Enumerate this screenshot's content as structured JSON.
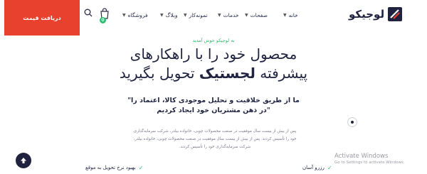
{
  "header": {
    "quote_button": "دریافت قیمت",
    "cart_count": "0",
    "logo_text": "لوجیکو",
    "nav": {
      "home": "خانه",
      "pages": "صفحات",
      "services": "خدمات",
      "sample": "نمونه‌کار",
      "blog": "وبلاگ",
      "shop": "فروشگاه"
    }
  },
  "hero": {
    "kicker": "به لوجیکو خوش آمدید",
    "heading_line1": "محصول خود را با راهکارهای",
    "heading_line2_pre": "پیشرفته ",
    "heading_line2_bold": "لجستیک",
    "heading_line2_post": " تحویل بگیرید",
    "quote_line1": "\"ما از طریق خلاقیت و تحلیل موجودی کالا، اعتماد را",
    "quote_line2": "در ذهن مشتریان خود ایجاد کردیم\"",
    "description": "پس از بیش از بیست سال موفقیت در صنعت محصولات چوبی، خانواده بیلدر، شرکت سرمایه‌گذاری خود را تأسیس کردند. پس از بیش از بیست سال موفقیت در صنعت محصولات چوبی، خانواده بیلدر، شرکت سرمایه‌گذاری خود را تأسیس کردند.",
    "features": {
      "right": "رزرو آسان",
      "left": "بهبود نرخ تحویل به موقع"
    }
  },
  "watermark": {
    "title": "Activate Windows",
    "subtitle": "Go to Settings to activate Windows."
  },
  "colors": {
    "accent": "#e8422f",
    "green": "#2dbd6e",
    "navy": "#1f2340"
  },
  "icons": {
    "search": "search-icon",
    "cart": "cart-icon",
    "chevron": "chevron-down-icon",
    "check": "check-icon",
    "up": "arrow-up-icon"
  }
}
